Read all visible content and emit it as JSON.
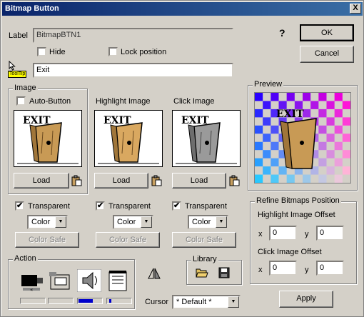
{
  "window": {
    "title": "Bitmap Button",
    "close_glyph": "X"
  },
  "label": {
    "caption": "Label",
    "value": "BitmapBTN1"
  },
  "hide": {
    "label": "Hide",
    "checked": false
  },
  "lock_position": {
    "label": "Lock position",
    "checked": false
  },
  "tooltip": {
    "flag": "ToolTip",
    "value": "Exit"
  },
  "help_glyph": "?",
  "ok_label": "OK",
  "cancel_label": "Cancel",
  "image_group": {
    "title": "Image",
    "auto_button": {
      "label": "Auto-Button",
      "checked": false
    },
    "highlight_caption": "Highlight Image",
    "click_caption": "Click Image",
    "load_label": "Load",
    "art_text": "EXIT"
  },
  "transparent": [
    {
      "label": "Transparent",
      "checked": true,
      "mode": "Color",
      "safe": "Color Safe"
    },
    {
      "label": "Transparent",
      "checked": true,
      "mode": "Color",
      "safe": "Color Safe"
    },
    {
      "label": "Transparent",
      "checked": true,
      "mode": "Color",
      "safe": "Color Safe"
    }
  ],
  "action_group": {
    "title": "Action"
  },
  "library_group": {
    "title": "Library"
  },
  "cursor": {
    "caption": "Cursor",
    "value": "* Default *"
  },
  "preview": {
    "title": "Preview"
  },
  "refine": {
    "title": "Refine Bitmaps Position",
    "highlight_offset": "Highlight Image Offset",
    "click_offset": "Click Image Offset",
    "x_label": "x",
    "y_label": "y",
    "hx": "0",
    "hy": "0",
    "cx": "0",
    "cy": "0"
  },
  "apply_label": "Apply",
  "colors": {
    "title_start": "#0a246a",
    "title_end": "#3a6ea5",
    "face": "#d4d0c8",
    "bar_blue": "#0000cc"
  }
}
